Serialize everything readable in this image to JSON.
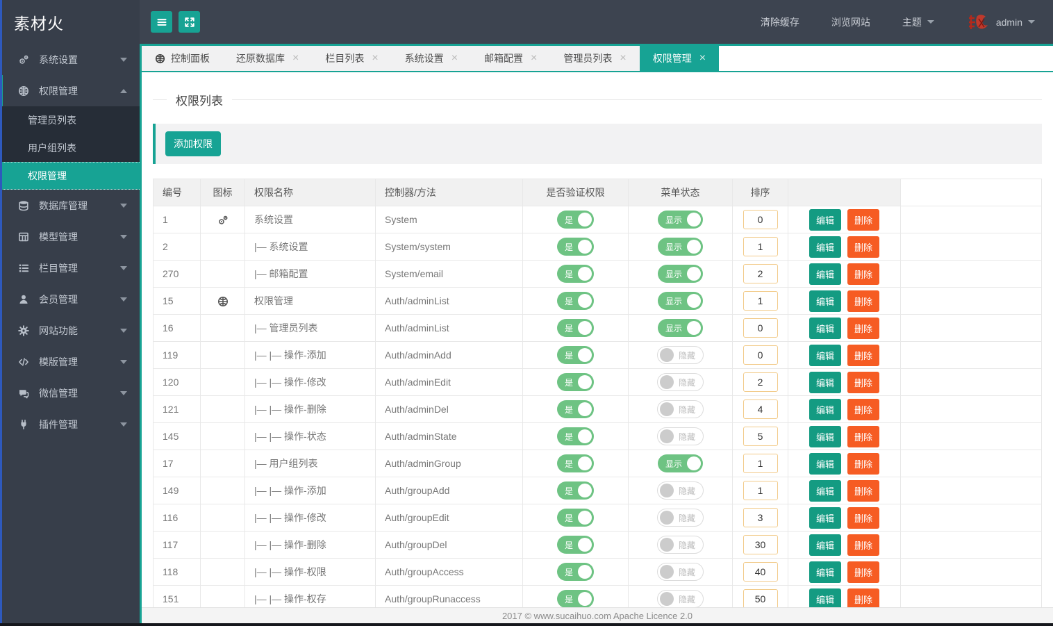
{
  "brand": {
    "logo": "素材火"
  },
  "topbar": {
    "menu_button_icon": "hamburger-icon",
    "fullscreen_button_icon": "expand-icon",
    "clear_cache": "清除缓存",
    "browse_site": "浏览网站",
    "theme_label": "主题",
    "username": "admin",
    "avatar_icon": "red-seal-avatar"
  },
  "sidebar": {
    "items": [
      {
        "label": "系统设置",
        "icon": "gears",
        "expanded": false
      },
      {
        "label": "权限管理",
        "icon": "globe",
        "expanded": true,
        "accent_bar": true,
        "children": [
          {
            "label": "管理员列表",
            "active": false
          },
          {
            "label": "用户组列表",
            "active": false
          },
          {
            "label": "权限管理",
            "active": true
          }
        ]
      },
      {
        "label": "数据库管理",
        "icon": "database",
        "expanded": false
      },
      {
        "label": "模型管理",
        "icon": "model",
        "expanded": false
      },
      {
        "label": "栏目管理",
        "icon": "list",
        "expanded": false
      },
      {
        "label": "会员管理",
        "icon": "user",
        "expanded": false
      },
      {
        "label": "网站功能",
        "icon": "gear",
        "expanded": false
      },
      {
        "label": "模版管理",
        "icon": "code",
        "expanded": false
      },
      {
        "label": "微信管理",
        "icon": "chat",
        "expanded": false
      },
      {
        "label": "插件管理",
        "icon": "plug",
        "expanded": false
      }
    ]
  },
  "tabs": {
    "items": [
      {
        "label": "控制面板",
        "icon": "globe",
        "closable": false,
        "active": false
      },
      {
        "label": "还原数据库",
        "closable": true,
        "active": false
      },
      {
        "label": "栏目列表",
        "closable": true,
        "active": false
      },
      {
        "label": "系统设置",
        "closable": true,
        "active": false
      },
      {
        "label": "邮箱配置",
        "closable": true,
        "active": false
      },
      {
        "label": "管理员列表",
        "closable": true,
        "active": false
      },
      {
        "label": "权限管理",
        "closable": true,
        "active": true
      }
    ]
  },
  "page": {
    "title": "权限列表",
    "add_button_label": "添加权限"
  },
  "table": {
    "headers": [
      "编号",
      "图标",
      "权限名称",
      "控制器/方法",
      "是否验证权限",
      "菜单状态",
      "排序",
      "",
      ""
    ],
    "labels": {
      "verify_on": "是",
      "menu_show": "显示",
      "menu_hide": "隐藏",
      "edit": "编辑",
      "delete": "删除"
    },
    "rows": [
      {
        "id": "1",
        "icon": "gears",
        "name": "系统设置",
        "controller": "System",
        "verify": "是",
        "menu": "show",
        "sort": "0"
      },
      {
        "id": "2",
        "icon": "",
        "name": "|— 系统设置",
        "controller": "System/system",
        "verify": "是",
        "menu": "show",
        "sort": "1"
      },
      {
        "id": "270",
        "icon": "",
        "name": "|— 邮箱配置",
        "controller": "System/email",
        "verify": "是",
        "menu": "show",
        "sort": "2"
      },
      {
        "id": "15",
        "icon": "globe",
        "name": "权限管理",
        "controller": "Auth/adminList",
        "verify": "是",
        "menu": "show",
        "sort": "1"
      },
      {
        "id": "16",
        "icon": "",
        "name": "|— 管理员列表",
        "controller": "Auth/adminList",
        "verify": "是",
        "menu": "show",
        "sort": "0"
      },
      {
        "id": "119",
        "icon": "",
        "name": "|— |— 操作-添加",
        "controller": "Auth/adminAdd",
        "verify": "是",
        "menu": "hide",
        "sort": "0"
      },
      {
        "id": "120",
        "icon": "",
        "name": "|— |— 操作-修改",
        "controller": "Auth/adminEdit",
        "verify": "是",
        "menu": "hide",
        "sort": "2"
      },
      {
        "id": "121",
        "icon": "",
        "name": "|— |— 操作-删除",
        "controller": "Auth/adminDel",
        "verify": "是",
        "menu": "hide",
        "sort": "4"
      },
      {
        "id": "145",
        "icon": "",
        "name": "|— |— 操作-状态",
        "controller": "Auth/adminState",
        "verify": "是",
        "menu": "hide",
        "sort": "5"
      },
      {
        "id": "17",
        "icon": "",
        "name": "|— 用户组列表",
        "controller": "Auth/adminGroup",
        "verify": "是",
        "menu": "show",
        "sort": "1"
      },
      {
        "id": "149",
        "icon": "",
        "name": "|— |— 操作-添加",
        "controller": "Auth/groupAdd",
        "verify": "是",
        "menu": "hide",
        "sort": "1"
      },
      {
        "id": "116",
        "icon": "",
        "name": "|— |— 操作-修改",
        "controller": "Auth/groupEdit",
        "verify": "是",
        "menu": "hide",
        "sort": "3"
      },
      {
        "id": "117",
        "icon": "",
        "name": "|— |— 操作-删除",
        "controller": "Auth/groupDel",
        "verify": "是",
        "menu": "hide",
        "sort": "30"
      },
      {
        "id": "118",
        "icon": "",
        "name": "|— |— 操作-权限",
        "controller": "Auth/groupAccess",
        "verify": "是",
        "menu": "hide",
        "sort": "40"
      },
      {
        "id": "151",
        "icon": "",
        "name": "|— |— 操作-权存",
        "controller": "Auth/groupRunaccess",
        "verify": "是",
        "menu": "hide",
        "sort": "50"
      }
    ]
  },
  "footer": {
    "text": "2017 ©  www.sucaihuo.com  Apache Licence 2.0"
  },
  "colors": {
    "accent": "#17a394",
    "toggle_on": "#6ec383",
    "delete_button": "#f65c23",
    "edit_button": "#149b82",
    "sort_input_border": "#f2cb8a",
    "sidebar_bg": "#373e4a",
    "topbar_bg": "#3d4450",
    "submenu_bg": "#262d37",
    "left_edge_blue": "#2e59bd"
  }
}
